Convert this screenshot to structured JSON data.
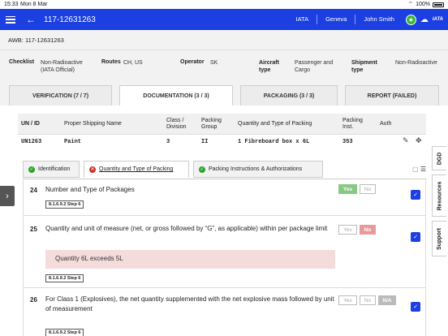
{
  "status": {
    "time": "15:33",
    "date": "Mon 8 Mar",
    "battery": "100%"
  },
  "header": {
    "title": "117-12631263",
    "iata": "IATA",
    "location": "Geneva",
    "user": "John Smith",
    "logo": "IATA"
  },
  "awb": {
    "text": "AWB: 117-12631263"
  },
  "info": {
    "checklist_label": "Checklist",
    "checklist_value": "Non-Radioactive (IATA Official)",
    "routes_label": "Routes",
    "routes_value": "CH, US",
    "operator_label": "Operator",
    "operator_value": "SK",
    "aircraft_label": "Aircraft type",
    "aircraft_value": "Passenger and Cargo",
    "shipment_label": "Shipment type",
    "shipment_value": "Non-Radioactive"
  },
  "tabs": [
    {
      "label": "VERIFICATION (7 / 7)"
    },
    {
      "label": "DOCUMENTATION (3 / 3)"
    },
    {
      "label": "PACKAGING (3 / 3)"
    },
    {
      "label": "REPORT (FAILED)"
    }
  ],
  "table": {
    "headers": [
      "UN / ID",
      "Proper Shipping Name",
      "Class / Division",
      "Packing Group",
      "Quantity and Type of Packing",
      "Packing Inst.",
      "Auth"
    ],
    "row": {
      "un": "UN1263",
      "name": "Paint",
      "class": "3",
      "group": "II",
      "qty": "1 Fibreboard box x 6L",
      "inst": "353"
    }
  },
  "subtabs": [
    {
      "label": "Identification",
      "status": "ok"
    },
    {
      "label": "Quantity and Type of Packing",
      "status": "error"
    },
    {
      "label": "Packing Instructions & Authorizations",
      "status": "ok"
    }
  ],
  "questions": [
    {
      "num": "24",
      "text": "Number and Type of Packages",
      "step": "8.1.6.9.2 Step 6",
      "yes": "Yes",
      "no": "No"
    },
    {
      "num": "25",
      "text": "Quantity and unit of measure (net, or gross followed by “G”, as applicable) within per package limit",
      "warning": "Quantity 6L exceeds 5L",
      "step": "8.1.6.9.2 Step 6",
      "yes": "Yes",
      "no": "No"
    },
    {
      "num": "26",
      "text": "For Class 1 (Explosives), the net quantity supplemented with the net explosive mass followed by unit of measurement",
      "step": "8.1.6.9.2 Step 6",
      "yes": "Yes",
      "no": "No",
      "na": "N/A"
    }
  ],
  "side_tabs": [
    "DGD",
    "Resources",
    "Support"
  ],
  "colors": {
    "primary": "#1b3fe0",
    "ok": "#2ba32b",
    "error": "#d0302a"
  }
}
